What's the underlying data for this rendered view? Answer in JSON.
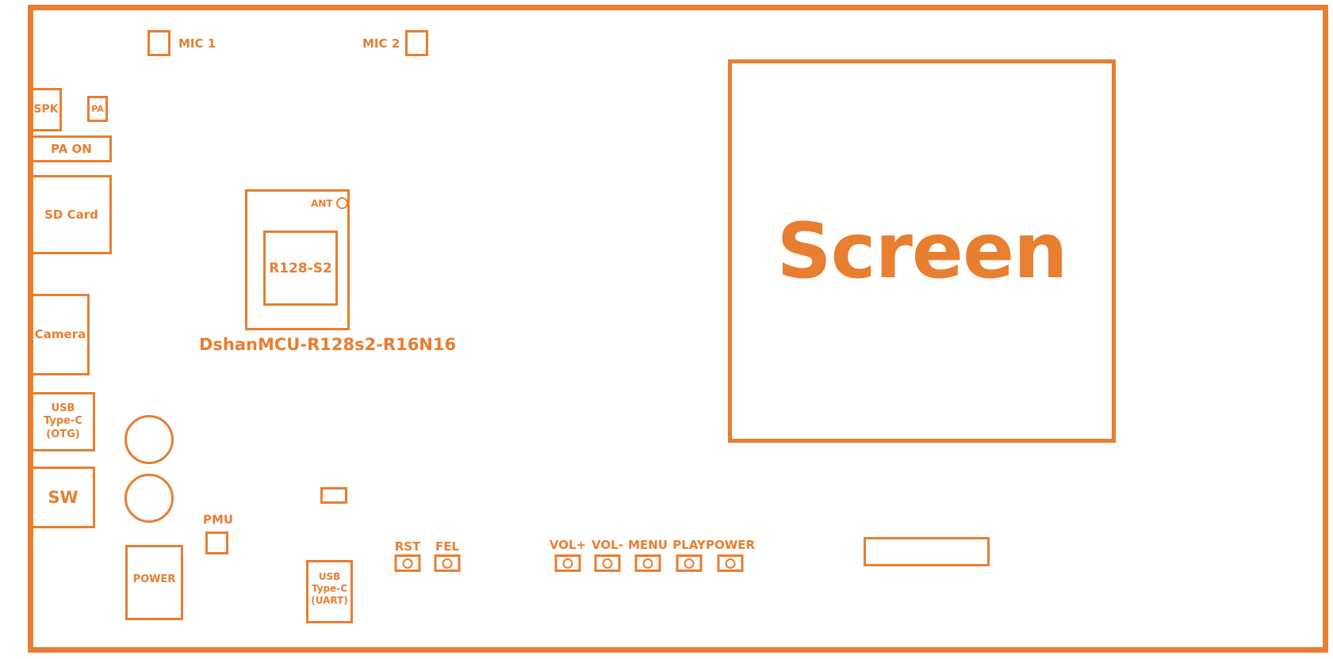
{
  "board": {
    "name": "DshanMCU-R128s2-R16N16",
    "accent_color": "#e87e30",
    "background_color": "#ffffff"
  },
  "module": {
    "chip_label": "R128-S2",
    "antenna_label": "ANT"
  },
  "screen": {
    "label": "Screen"
  },
  "components": [
    {
      "id": "mic1",
      "label": "MIC 1"
    },
    {
      "id": "mic2",
      "label": "MIC 2"
    },
    {
      "id": "spk",
      "label": "SPK"
    },
    {
      "id": "pa",
      "label": "PA"
    },
    {
      "id": "pa-on",
      "label": "PA ON"
    },
    {
      "id": "sd-card",
      "label": "SD Card"
    },
    {
      "id": "camera",
      "label": "Camera"
    },
    {
      "id": "usb-otg",
      "label": "USB\nType-C\n(OTG)"
    },
    {
      "id": "sw",
      "label": "SW"
    },
    {
      "id": "pmu",
      "label": "PMU"
    },
    {
      "id": "power",
      "label": "POWER"
    },
    {
      "id": "usb-uart",
      "label": "USB\nType-C\n(UART)"
    }
  ],
  "labels": {
    "mic1": "MIC 1",
    "mic2": "MIC 2",
    "spk": "SPK",
    "pa": "PA",
    "pa_on": "PA ON",
    "sd_card": "SD Card",
    "camera": "Camera",
    "usb_otg_line1": "USB",
    "usb_otg_line2": "Type-C",
    "usb_otg_line3": "(OTG)",
    "sw": "SW",
    "pmu": "PMU",
    "power": "POWER",
    "usb_uart_line1": "USB",
    "usb_uart_line2": "Type-C",
    "usb_uart_line3": "(UART)"
  },
  "buttons": [
    {
      "id": "rst",
      "label": "RST"
    },
    {
      "id": "fel",
      "label": "FEL"
    },
    {
      "id": "vol-up",
      "label": "VOL+"
    },
    {
      "id": "vol-dn",
      "label": "VOL-"
    },
    {
      "id": "menu",
      "label": "MENU"
    },
    {
      "id": "play",
      "label": "PLAY"
    },
    {
      "id": "power",
      "label": "POWER"
    }
  ]
}
